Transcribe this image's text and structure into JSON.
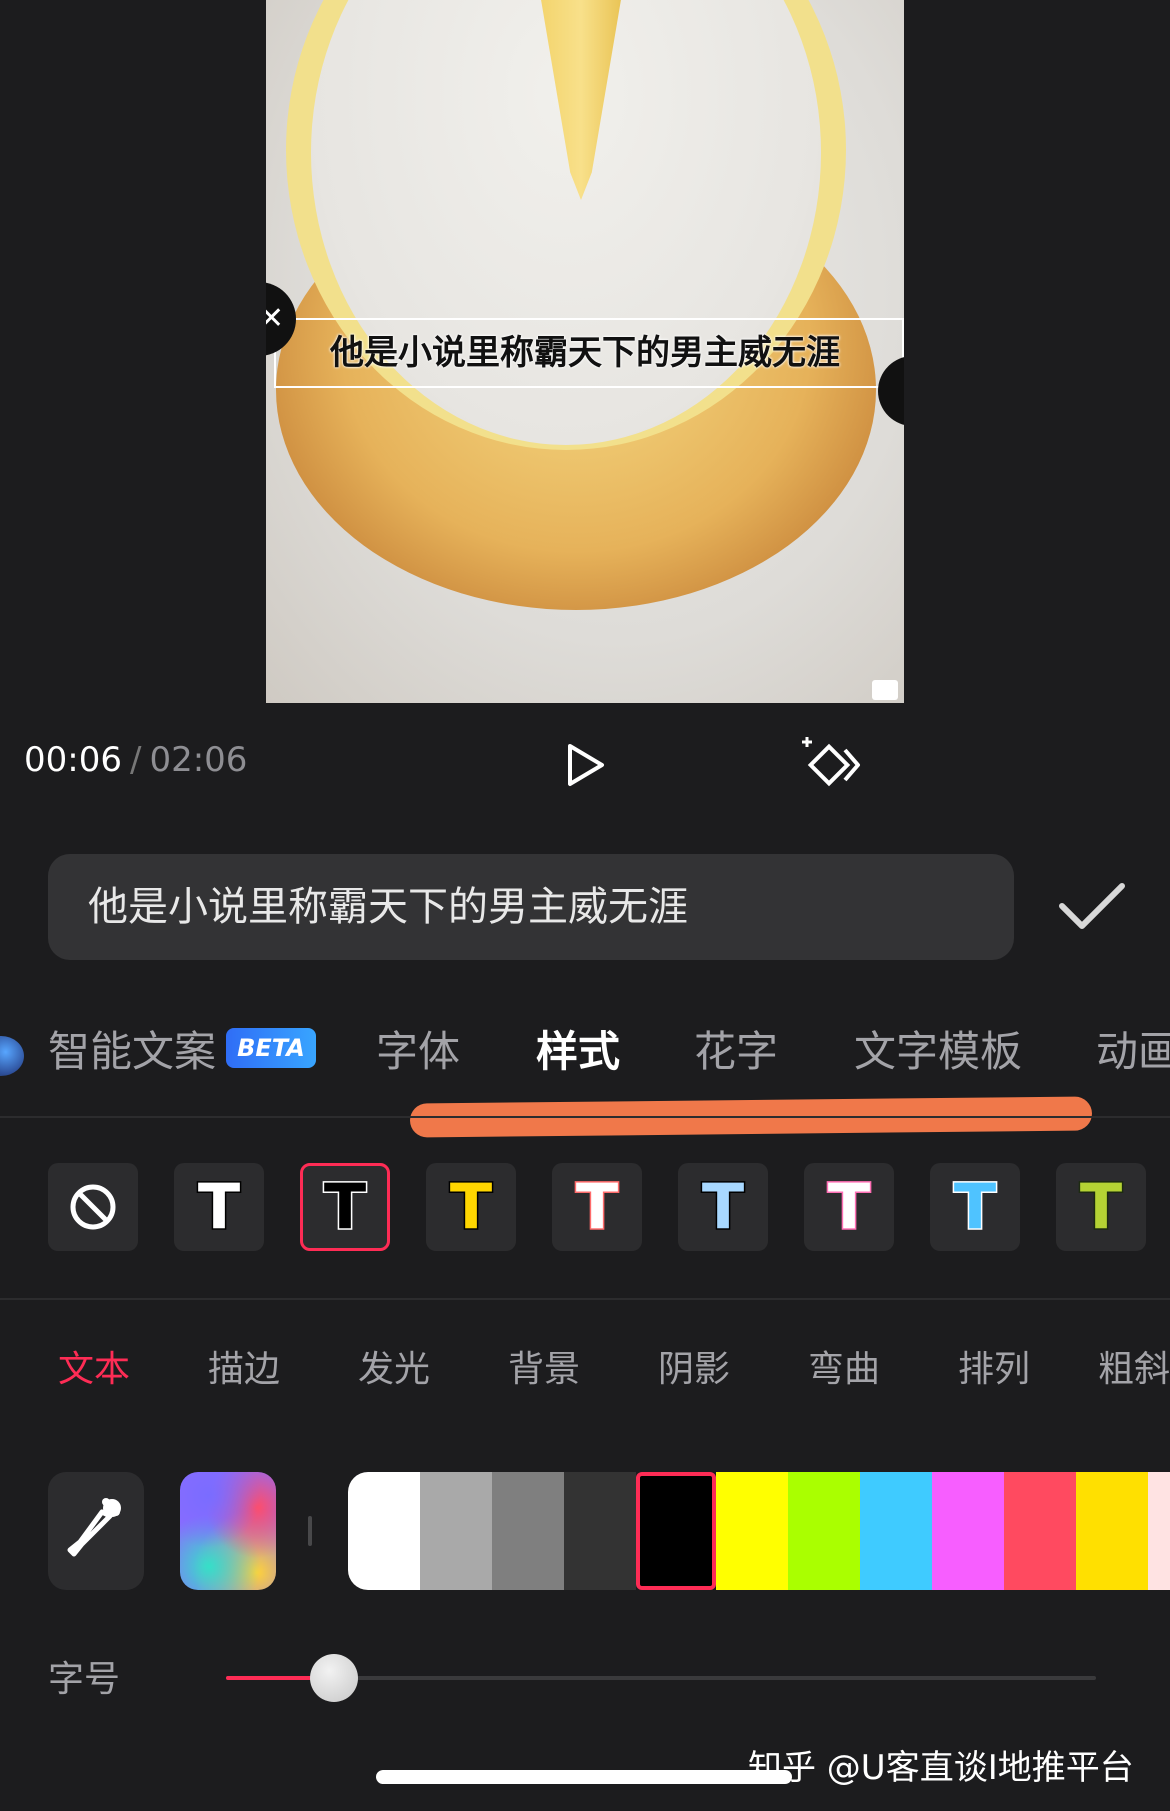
{
  "preview": {
    "caption": "他是小说里称霸天下的男主威无涯"
  },
  "player": {
    "current_time": "00:06",
    "separator": "/",
    "total_time": "02:06",
    "play_icon": "play-icon",
    "keyframe_icon": "keyframe-add-icon"
  },
  "text_input": {
    "value": "他是小说里称霸天下的男主威无涯"
  },
  "tabs": [
    {
      "label": "智能文案",
      "badge": "BETA"
    },
    {
      "label": "字体"
    },
    {
      "label": "样式",
      "active": true
    },
    {
      "label": "花字"
    },
    {
      "label": "文字模板"
    },
    {
      "label": "动画"
    }
  ],
  "style_presets": [
    {
      "name": "none",
      "icon": "no-style-icon"
    },
    {
      "glyph": "T",
      "fill": "#ffffff",
      "stroke": "#000000"
    },
    {
      "glyph": "T",
      "fill": "#000000",
      "stroke": "#ffffff",
      "selected": true
    },
    {
      "glyph": "T",
      "fill": "#ffd600",
      "stroke": "#000000"
    },
    {
      "glyph": "T",
      "fill": "#ffffff",
      "stroke": "#ff6b6b"
    },
    {
      "glyph": "T",
      "fill": "#a8d8ff",
      "stroke": "#000000"
    },
    {
      "glyph": "T",
      "fill": "#ffffff",
      "stroke": "#ff6fb5"
    },
    {
      "glyph": "T",
      "fill": "#4fc3ff",
      "stroke": "#ffffff"
    },
    {
      "glyph": "T",
      "fill": "#b5d334",
      "stroke": "#1d2b10"
    }
  ],
  "sub_tabs": [
    {
      "label": "文本",
      "active": true
    },
    {
      "label": "描边"
    },
    {
      "label": "发光"
    },
    {
      "label": "背景"
    },
    {
      "label": "阴影"
    },
    {
      "label": "弯曲"
    },
    {
      "label": "排列"
    },
    {
      "label": "粗斜"
    }
  ],
  "colors": {
    "accent": "#fe2c55",
    "swatches": [
      "#ffffff",
      "#a9a9a9",
      "#7f7f7f",
      "#333333",
      "#000000",
      "#ffff00",
      "#aaff00",
      "#3fcbff",
      "#f75eff",
      "#ff4a60",
      "#ffe000",
      "#ffe3e3"
    ],
    "selected_index": 4
  },
  "font_size": {
    "label": "字号",
    "value_fraction": 0.124
  },
  "watermark": "知乎 @U客直谈I地推平台"
}
